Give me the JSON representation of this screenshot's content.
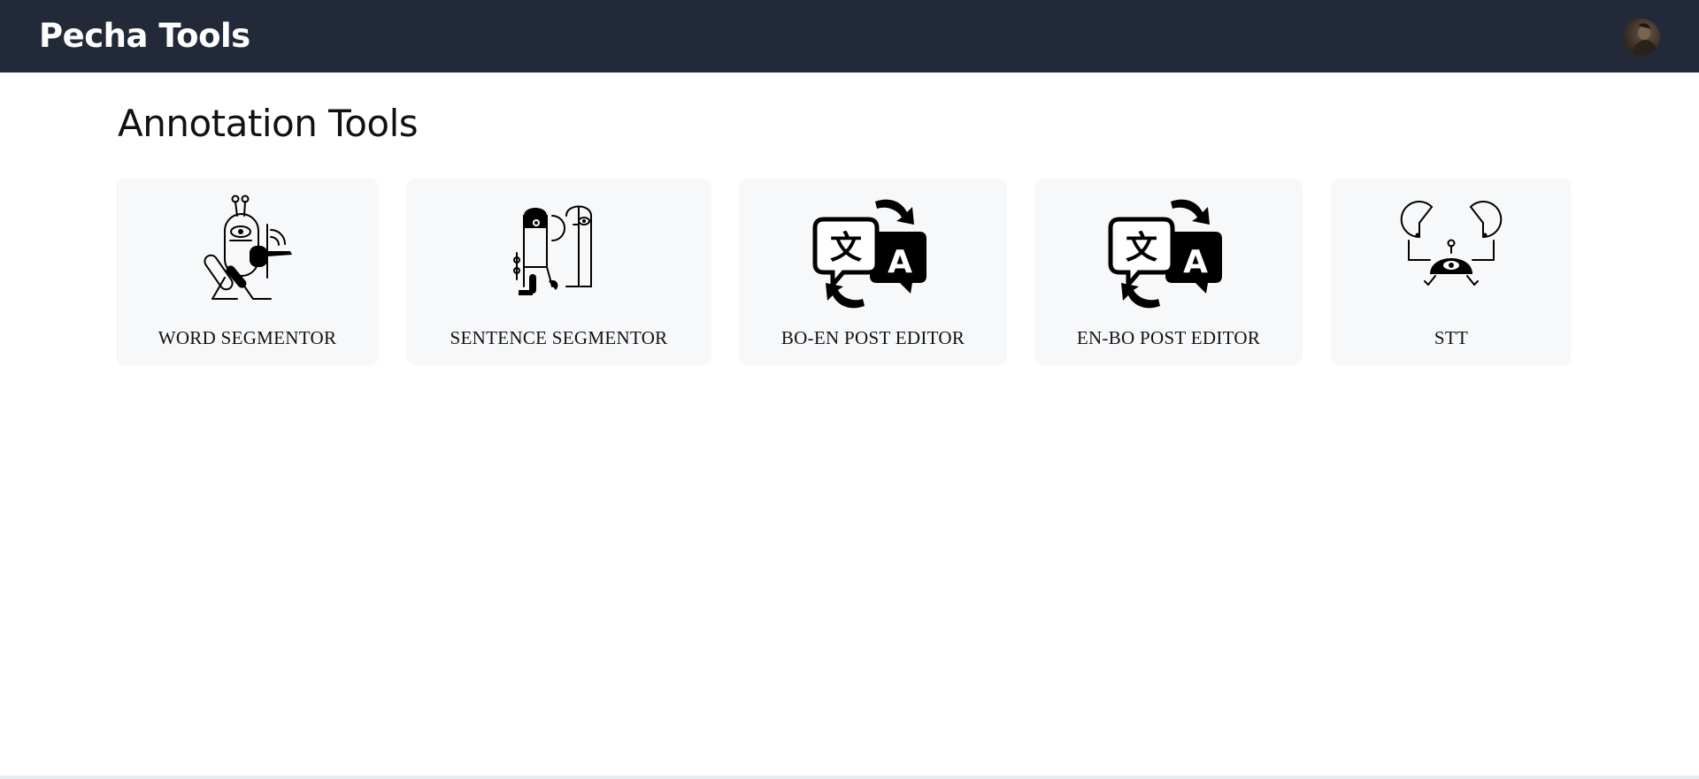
{
  "header": {
    "brand": "Pecha Tools",
    "avatar_alt": "User avatar"
  },
  "main": {
    "title": "Annotation Tools",
    "tools": [
      {
        "label": "WORD SEGMENTOR",
        "icon": "word-segmentor-illustration"
      },
      {
        "label": "SENTENCE SEGMENTOR",
        "icon": "sentence-segmentor-illustration"
      },
      {
        "label": "BO-EN POST EDITOR",
        "icon": "translate-icon"
      },
      {
        "label": "EN-BO POST EDITOR",
        "icon": "translate-icon"
      },
      {
        "label": "STT",
        "icon": "stt-illustration"
      }
    ]
  },
  "colors": {
    "header_bg": "#222a39",
    "card_bg": "#f7f8fa",
    "text": "#111111"
  }
}
